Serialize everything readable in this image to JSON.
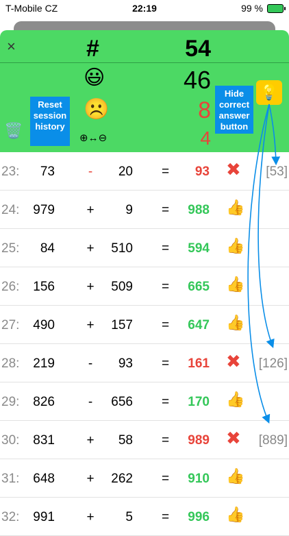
{
  "status_bar": {
    "carrier": "T-Mobile CZ",
    "time": "22:19",
    "battery": "99 %"
  },
  "header": {
    "close_icon": "×",
    "hash": "#",
    "total": "54",
    "correct_icon": "😃",
    "correct": "46",
    "wrong_icon": "☹️",
    "wrong": "8",
    "mode_icon": "⊕↔⊖",
    "remaining": "4",
    "trash_icon": "🗑️",
    "bulb_icon": "💡"
  },
  "callouts": {
    "reset_history": "Reset session history",
    "hide_answer": "Hide correct answer button"
  },
  "icons": {
    "correct_mark": "👍",
    "wrong_mark": "✖"
  },
  "rows": [
    {
      "num": "23:",
      "a": "73",
      "op": "-",
      "b": "20",
      "eq": "=",
      "res": "93",
      "ok": false,
      "ans": "[53]"
    },
    {
      "num": "24:",
      "a": "979",
      "op": "+",
      "b": "9",
      "eq": "=",
      "res": "988",
      "ok": true,
      "ans": ""
    },
    {
      "num": "25:",
      "a": "84",
      "op": "+",
      "b": "510",
      "eq": "=",
      "res": "594",
      "ok": true,
      "ans": ""
    },
    {
      "num": "26:",
      "a": "156",
      "op": "+",
      "b": "509",
      "eq": "=",
      "res": "665",
      "ok": true,
      "ans": ""
    },
    {
      "num": "27:",
      "a": "490",
      "op": "+",
      "b": "157",
      "eq": "=",
      "res": "647",
      "ok": true,
      "ans": ""
    },
    {
      "num": "28:",
      "a": "219",
      "op": "-",
      "b": "93",
      "eq": "=",
      "res": "161",
      "ok": false,
      "ans": "[126]"
    },
    {
      "num": "29:",
      "a": "826",
      "op": "-",
      "b": "656",
      "eq": "=",
      "res": "170",
      "ok": true,
      "ans": ""
    },
    {
      "num": "30:",
      "a": "831",
      "op": "+",
      "b": "58",
      "eq": "=",
      "res": "989",
      "ok": false,
      "ans": "[889]"
    },
    {
      "num": "31:",
      "a": "648",
      "op": "+",
      "b": "262",
      "eq": "=",
      "res": "910",
      "ok": true,
      "ans": ""
    },
    {
      "num": "32:",
      "a": "991",
      "op": "+",
      "b": "5",
      "eq": "=",
      "res": "996",
      "ok": true,
      "ans": ""
    }
  ]
}
